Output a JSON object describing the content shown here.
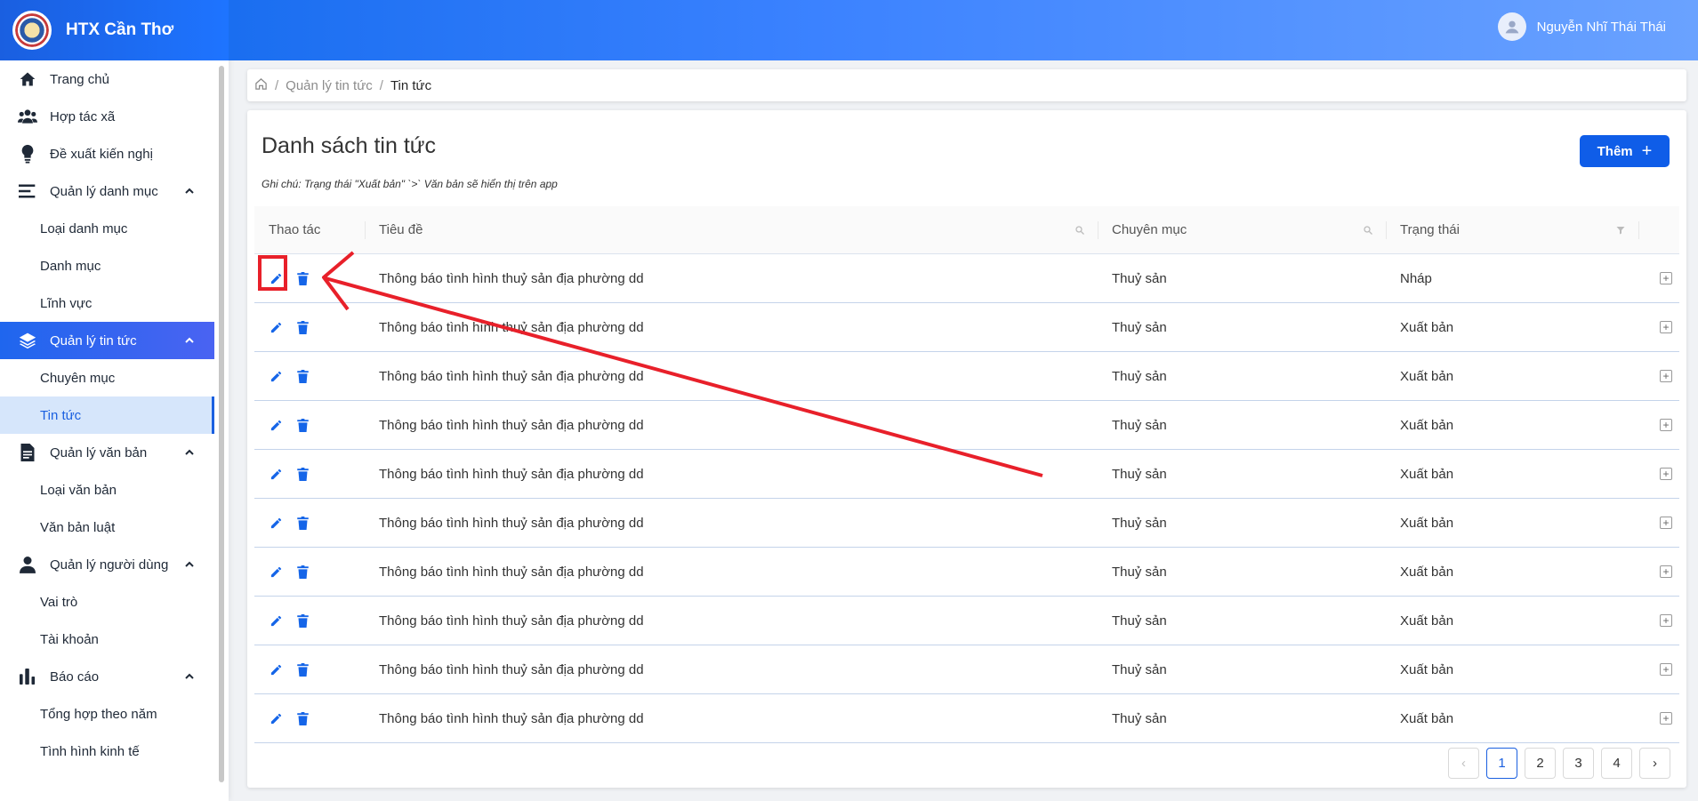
{
  "brand": {
    "title": "HTX Cần Thơ"
  },
  "user": {
    "name": "Nguyễn Nhĩ Thái Thái"
  },
  "sidebar": {
    "items": [
      {
        "label": "Trang chủ",
        "icon": "home-icon"
      },
      {
        "label": "Hợp tác xã",
        "icon": "users-icon"
      },
      {
        "label": "Đề xuất kiến nghị",
        "icon": "lightbulb-icon"
      },
      {
        "label": "Quản lý danh mục",
        "icon": "list-icon",
        "expanded": true,
        "children": [
          "Loại danh mục",
          "Danh mục",
          "Lĩnh vực"
        ]
      },
      {
        "label": "Quản lý tin tức",
        "icon": "layers-icon",
        "expanded": true,
        "active": true,
        "children": [
          "Chuyên mục",
          "Tin tức"
        ]
      },
      {
        "label": "Quản lý văn bản",
        "icon": "document-icon",
        "expanded": true,
        "children": [
          "Loại văn bản",
          "Văn bản luật"
        ]
      },
      {
        "label": "Quản lý người dùng",
        "icon": "user-icon",
        "expanded": true,
        "children": [
          "Vai trò",
          "Tài khoản"
        ]
      },
      {
        "label": "Báo cáo",
        "icon": "bar-chart-icon",
        "expanded": true,
        "children": [
          "Tổng hợp theo năm",
          "Tình hình kinh tế"
        ]
      }
    ],
    "active_sub": "Tin tức"
  },
  "breadcrumb": {
    "parent": "Quản lý tin tức",
    "current": "Tin tức"
  },
  "page": {
    "title": "Danh sách tin tức",
    "note": "Ghi chú: Trạng thái \"Xuất bản\" `>` Văn bản sẽ hiển thị trên app",
    "add_label": "Thêm"
  },
  "table": {
    "columns": [
      "Thao tác",
      "Tiêu đề",
      "Chuyên mục",
      "Trạng thái"
    ],
    "rows": [
      {
        "title": "Thông báo tình hình thuỷ sản địa phường dd",
        "category": "Thuỷ sản",
        "status": "Nháp"
      },
      {
        "title": "Thông báo tình hình thuỷ sản địa phường dd",
        "category": "Thuỷ sản",
        "status": "Xuất bản"
      },
      {
        "title": "Thông báo tình hình thuỷ sản địa phường dd",
        "category": "Thuỷ sản",
        "status": "Xuất bản"
      },
      {
        "title": "Thông báo tình hình thuỷ sản địa phường dd",
        "category": "Thuỷ sản",
        "status": "Xuất bản"
      },
      {
        "title": "Thông báo tình hình thuỷ sản địa phường dd",
        "category": "Thuỷ sản",
        "status": "Xuất bản"
      },
      {
        "title": "Thông báo tình hình thuỷ sản địa phường dd",
        "category": "Thuỷ sản",
        "status": "Xuất bản"
      },
      {
        "title": "Thông báo tình hình thuỷ sản địa phường dd",
        "category": "Thuỷ sản",
        "status": "Xuất bản"
      },
      {
        "title": "Thông báo tình hình thuỷ sản địa phường dd",
        "category": "Thuỷ sản",
        "status": "Xuất bản"
      },
      {
        "title": "Thông báo tình hình thuỷ sản địa phường dd",
        "category": "Thuỷ sản",
        "status": "Xuất bản"
      },
      {
        "title": "Thông báo tình hình thuỷ sản địa phường dd",
        "category": "Thuỷ sản",
        "status": "Xuất bản"
      }
    ]
  },
  "pagination": {
    "pages": [
      "1",
      "2",
      "3",
      "4"
    ],
    "current": "1",
    "prev": "‹",
    "next": "›"
  },
  "colors": {
    "primary": "#0f5de8",
    "annotation": "#e8202a",
    "active_bg": "#d6e6fb"
  }
}
